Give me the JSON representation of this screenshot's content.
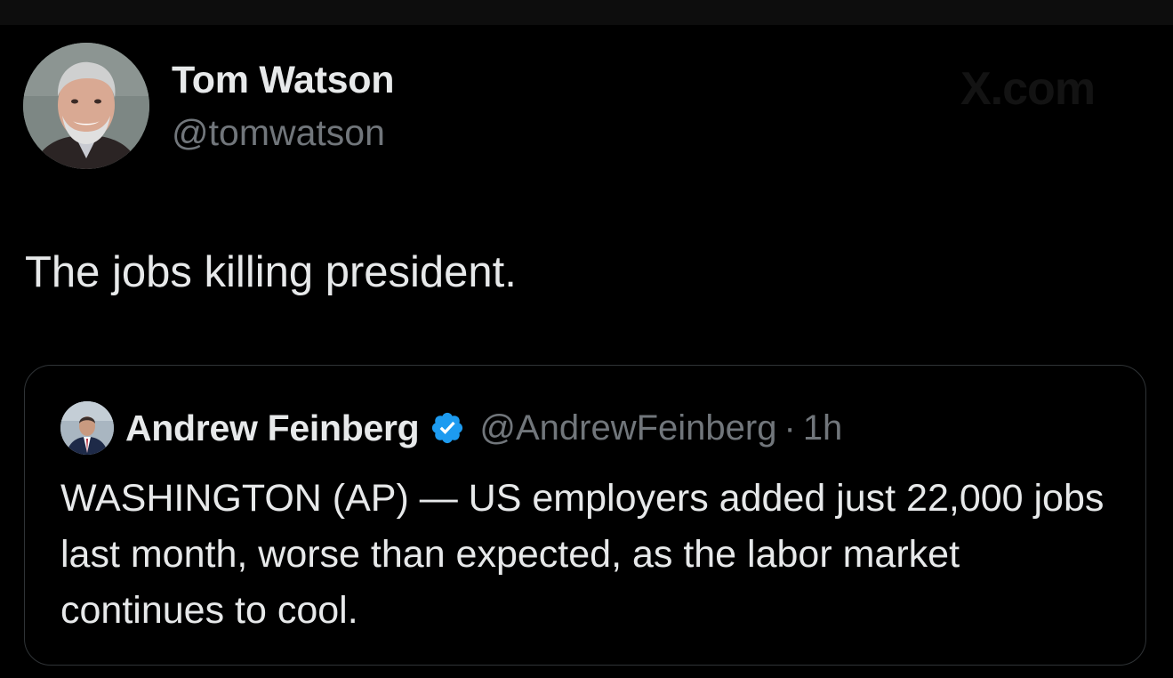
{
  "tweet": {
    "author": {
      "name": "Tom Watson",
      "handle": "@tomwatson",
      "avatar_icon": "profile-photo"
    },
    "text": "The jobs killing president.",
    "watermark": "X.com"
  },
  "quoted_tweet": {
    "author": {
      "name": "Andrew Feinberg",
      "handle": "@AndrewFeinberg",
      "verified": true,
      "verified_color": "#1d9bf0",
      "avatar_icon": "profile-photo"
    },
    "separator": "·",
    "time": "1h",
    "text": "WASHINGTON (AP) — US employers added just 22,000 jobs last month, worse than expected, as the labor market continues to cool."
  }
}
